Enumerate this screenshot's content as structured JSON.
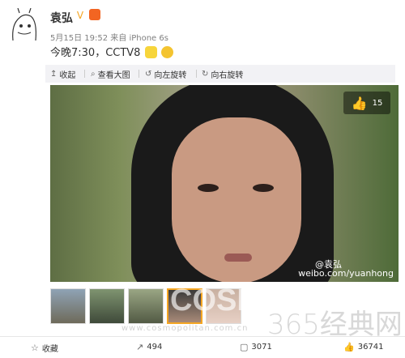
{
  "post": {
    "username": "袁弘",
    "meta": "5月15日 19:52 来自 iPhone 6s",
    "text": "今晚7:30，CCTV8"
  },
  "toolbar": {
    "collapse": "收起",
    "view_large": "查看大图",
    "rotate_left": "向左旋转",
    "rotate_right": "向右旋转"
  },
  "photo": {
    "like_count": "15",
    "watermark_logo": "@袁弘",
    "watermark_url": "weibo.com/yuanhong"
  },
  "bottom_bar": {
    "favorite": "收藏",
    "share_count": "494",
    "comment_count": "3071",
    "like_count": "36741"
  },
  "overlay": {
    "cosmo": "COSMO",
    "cosmo_url": "www.cosmopolitan.com.cn",
    "site": "365经典网"
  },
  "colors": {
    "vip": "#f5a623",
    "toolbar_bg": "#f2f2f5",
    "selected_border": "#f5a623"
  }
}
